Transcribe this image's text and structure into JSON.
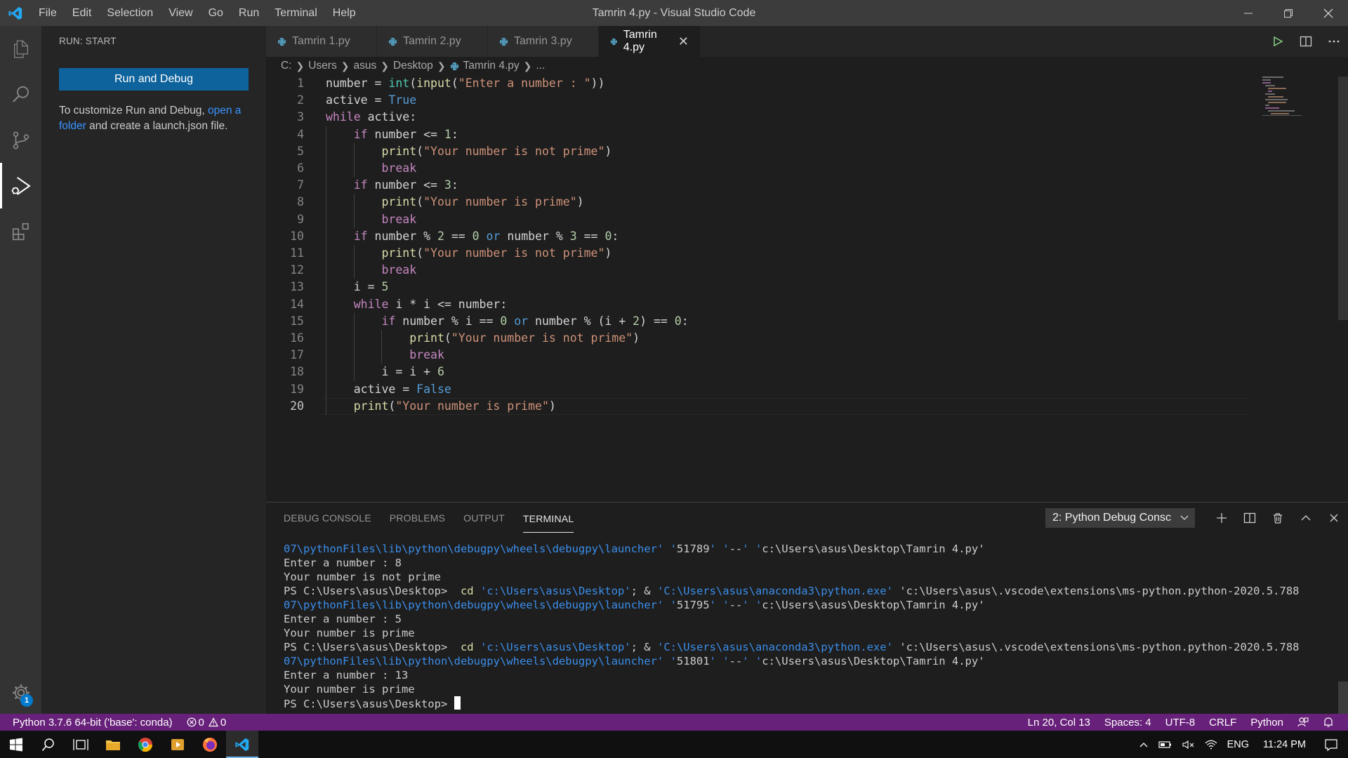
{
  "window": {
    "title": "Tamrin 4.py - Visual Studio Code",
    "menu": [
      "File",
      "Edit",
      "Selection",
      "View",
      "Go",
      "Run",
      "Terminal",
      "Help"
    ]
  },
  "sidebar": {
    "title": "RUN: START",
    "run_button": "Run and Debug",
    "text_before": "To customize Run and Debug, ",
    "link": "open a folder",
    "text_after": " and create a launch.json file."
  },
  "tabs": [
    {
      "label": "Tamrin 1.py",
      "active": false
    },
    {
      "label": "Tamrin 2.py",
      "active": false
    },
    {
      "label": "Tamrin 3.py",
      "active": false
    },
    {
      "label": "Tamrin 4.py",
      "active": true
    }
  ],
  "breadcrumb": [
    "C:",
    "Users",
    "asus",
    "Desktop",
    "Tamrin 4.py",
    "..."
  ],
  "code_lines": [
    "number = int(input(\"Enter a number : \"))",
    "active = True",
    "while active:",
    "    if number <= 1:",
    "        print(\"Your number is not prime\")",
    "        break",
    "    if number <= 3:",
    "        print(\"Your number is prime\")",
    "        break",
    "    if number % 2 == 0 or number % 3 == 0:",
    "        print(\"Your number is not prime\")",
    "        break",
    "    i = 5",
    "    while i * i <= number:",
    "        if number % i == 0 or number % (i + 2) == 0:",
    "            print(\"Your number is not prime\")",
    "            break",
    "        i = i + 6",
    "    active = False",
    "    print(\"Your number is prime\")"
  ],
  "panel": {
    "tabs": [
      "DEBUG CONSOLE",
      "PROBLEMS",
      "OUTPUT",
      "TERMINAL"
    ],
    "active_tab": "TERMINAL",
    "terminal_select": "2: Python Debug Consc",
    "terminal_lines": [
      "07\\pythonFiles\\lib\\python\\debugpy\\wheels\\debugpy\\launcher' '51789' '--' 'c:\\Users\\asus\\Desktop\\Tamrin 4.py'",
      "Enter a number : 8",
      "Your number is not prime",
      "PS C:\\Users\\asus\\Desktop>  cd 'c:\\Users\\asus\\Desktop'; & 'C:\\Users\\asus\\anaconda3\\python.exe' 'c:\\Users\\asus\\.vscode\\extensions\\ms-python.python-2020.5.788",
      "07\\pythonFiles\\lib\\python\\debugpy\\wheels\\debugpy\\launcher' '51795' '--' 'c:\\Users\\asus\\Desktop\\Tamrin 4.py'",
      "Enter a number : 5",
      "Your number is prime",
      "PS C:\\Users\\asus\\Desktop>  cd 'c:\\Users\\asus\\Desktop'; & 'C:\\Users\\asus\\anaconda3\\python.exe' 'c:\\Users\\asus\\.vscode\\extensions\\ms-python.python-2020.5.788",
      "07\\pythonFiles\\lib\\python\\debugpy\\wheels\\debugpy\\launcher' '51801' '--' 'c:\\Users\\asus\\Desktop\\Tamrin 4.py'",
      "Enter a number : 13",
      "Your number is prime",
      "PS C:\\Users\\asus\\Desktop> "
    ]
  },
  "statusbar": {
    "interpreter": "Python 3.7.6 64-bit ('base': conda)",
    "errors": "0",
    "warnings": "0",
    "position": "Ln 20, Col 13",
    "spaces": "Spaces: 4",
    "encoding": "UTF-8",
    "eol": "CRLF",
    "language": "Python"
  },
  "taskbar": {
    "lang": "ENG",
    "time": "11:24 PM"
  },
  "settings_badge": "1",
  "colors": {
    "statusbar": "#68217a",
    "accent": "#0e639c",
    "link": "#3794ff"
  }
}
